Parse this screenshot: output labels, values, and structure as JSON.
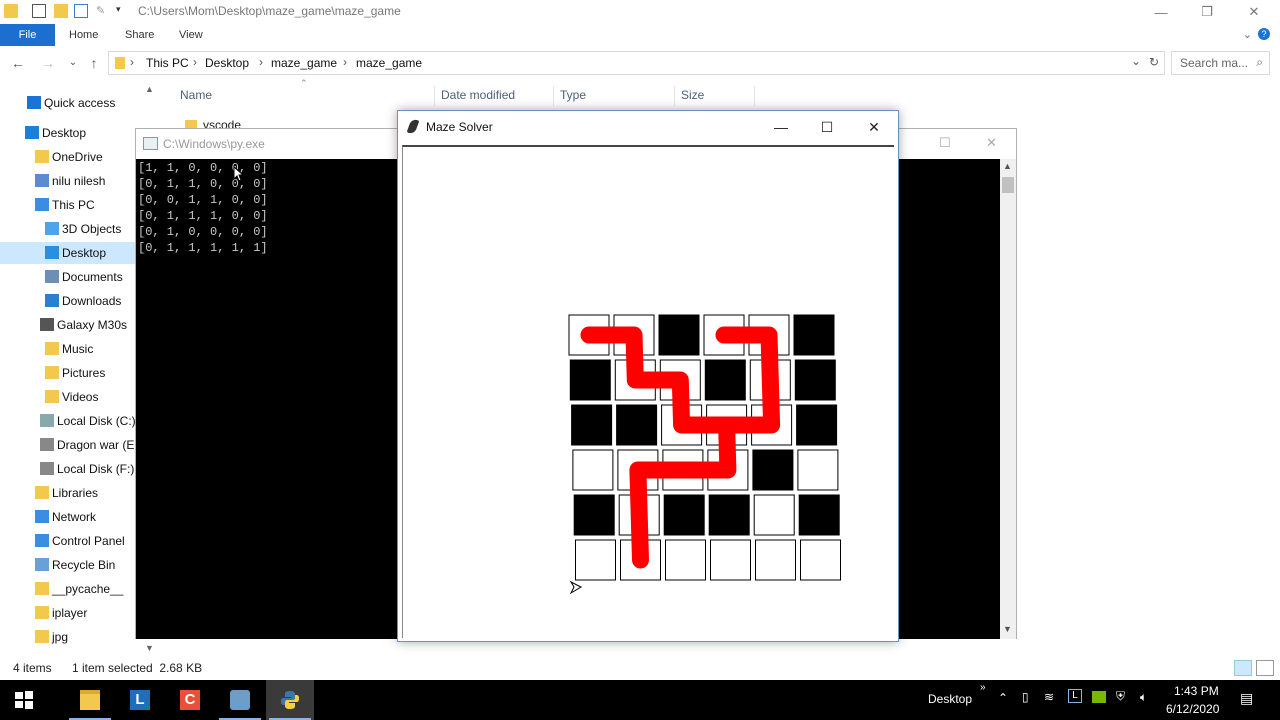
{
  "explorer": {
    "title_path": "C:\\Users\\Mom\\Desktop\\maze_game\\maze_game",
    "ribbon_tabs": [
      "File",
      "Home",
      "Share",
      "View"
    ],
    "breadcrumb": [
      "This PC",
      "Desktop",
      "maze_game",
      "maze_game"
    ],
    "search_placeholder": "Search ma...",
    "nav_items": [
      {
        "label": "Quick access",
        "icon": "star-icon",
        "color": "#1a74d8"
      },
      {
        "label": "Desktop",
        "icon": "desktop-icon",
        "color": "#1a80d8"
      },
      {
        "label": "OneDrive",
        "icon": "folder-icon",
        "color": "#f2c94c"
      },
      {
        "label": "nilu nilesh",
        "icon": "user-icon",
        "color": "#5b8bd0"
      },
      {
        "label": "This PC",
        "icon": "computer-icon",
        "color": "#3a8de0"
      },
      {
        "label": "3D Objects",
        "icon": "cube-icon",
        "color": "#4fa3e8"
      },
      {
        "label": "Desktop",
        "icon": "desktop-icon",
        "color": "#2a8fe0"
      },
      {
        "label": "Documents",
        "icon": "document-icon",
        "color": "#6d8fb6"
      },
      {
        "label": "Downloads",
        "icon": "download-icon",
        "color": "#2a7fd0"
      },
      {
        "label": "Galaxy M30s",
        "icon": "phone-icon",
        "color": "#555555"
      },
      {
        "label": "Music",
        "icon": "music-icon",
        "color": "#f2c94c"
      },
      {
        "label": "Pictures",
        "icon": "picture-icon",
        "color": "#f2c94c"
      },
      {
        "label": "Videos",
        "icon": "video-icon",
        "color": "#f2c94c"
      },
      {
        "label": "Local Disk (C:)",
        "icon": "drive-icon",
        "color": "#8aa"
      },
      {
        "label": "Dragon war (E",
        "icon": "drive-icon",
        "color": "#888"
      },
      {
        "label": "Local Disk (F:)",
        "icon": "drive-icon",
        "color": "#888"
      },
      {
        "label": "Libraries",
        "icon": "library-icon",
        "color": "#f2c94c"
      },
      {
        "label": "Network",
        "icon": "network-icon",
        "color": "#3a8de0"
      },
      {
        "label": "Control Panel",
        "icon": "control-panel-icon",
        "color": "#3a8de0"
      },
      {
        "label": "Recycle Bin",
        "icon": "recycle-bin-icon",
        "color": "#6aa0d8"
      },
      {
        "label": "__pycache__",
        "icon": "folder-icon",
        "color": "#f2c94c"
      },
      {
        "label": "iplayer",
        "icon": "folder-icon",
        "color": "#f2c94c"
      },
      {
        "label": "jpg",
        "icon": "folder-icon",
        "color": "#f2c94c"
      }
    ],
    "columns": [
      "Name",
      "Date modified",
      "Type",
      "Size"
    ],
    "first_row": "vscode",
    "status_items": "4 items",
    "status_selected": "1 item selected  2.68 KB"
  },
  "console": {
    "title": "C:\\Windows\\py.exe",
    "lines": [
      "[1, 1, 0, 0, 0, 0]",
      "[0, 1, 1, 0, 0, 0]",
      "[0, 0, 1, 1, 0, 0]",
      "[0, 1, 1, 1, 0, 0]",
      "[0, 1, 0, 0, 0, 0]",
      "[0, 1, 1, 1, 1, 1]"
    ]
  },
  "maze_window": {
    "title": "Maze Solver",
    "grid": [
      [
        0,
        0,
        1,
        0,
        0,
        1
      ],
      [
        1,
        0,
        0,
        1,
        0,
        1
      ],
      [
        1,
        1,
        0,
        0,
        0,
        1
      ],
      [
        0,
        0,
        0,
        0,
        1,
        0
      ],
      [
        1,
        0,
        1,
        1,
        0,
        1
      ],
      [
        0,
        0,
        0,
        0,
        0,
        0
      ]
    ],
    "path_color": "#ff0000",
    "wall_color": "#000000"
  },
  "taskbar": {
    "desktop_label": "Desktop",
    "time": "1:43 PM",
    "date": "6/12/2020",
    "accent": "#8ab4e8"
  }
}
